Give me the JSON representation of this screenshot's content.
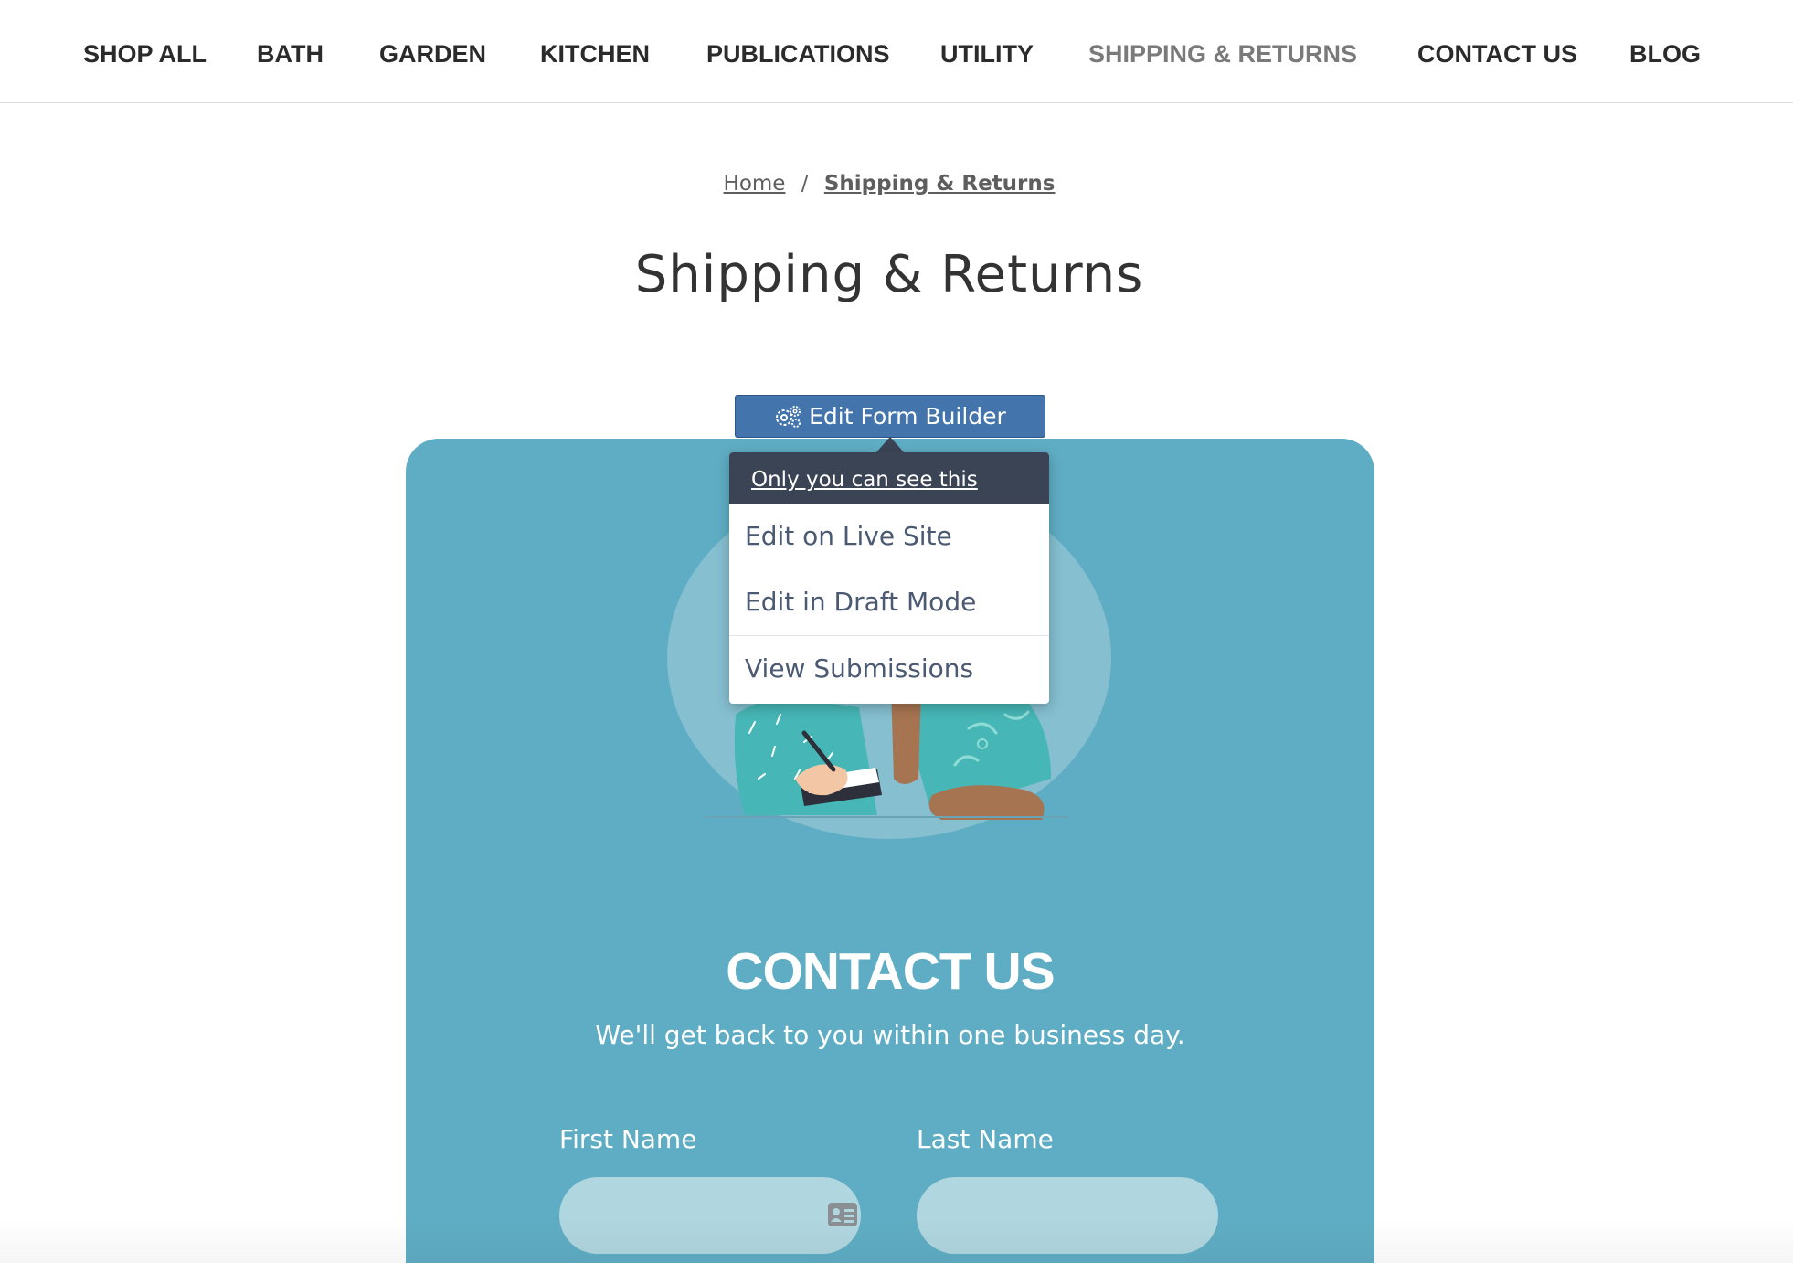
{
  "nav": {
    "items": [
      {
        "label": "SHOP ALL"
      },
      {
        "label": "BATH"
      },
      {
        "label": "GARDEN"
      },
      {
        "label": "KITCHEN"
      },
      {
        "label": "PUBLICATIONS"
      },
      {
        "label": "UTILITY"
      },
      {
        "label": "SHIPPING & RETURNS",
        "active": true
      },
      {
        "label": "CONTACT US"
      },
      {
        "label": "BLOG"
      }
    ]
  },
  "breadcrumb": {
    "home": "Home",
    "separator": "/",
    "current": "Shipping & Returns"
  },
  "page": {
    "title": "Shipping & Returns"
  },
  "form_builder": {
    "button_label": "Edit Form Builder",
    "button_icon": "gears-icon",
    "menu": {
      "header": "Only you can see this",
      "items": [
        {
          "label": "Edit on Live Site"
        },
        {
          "label": "Edit in Draft Mode"
        },
        {
          "label": "View Submissions"
        }
      ]
    }
  },
  "form": {
    "title": "CONTACT US",
    "subtitle": "We'll get back to you within one business day.",
    "fields": [
      {
        "label": "First Name",
        "value": "",
        "icon": "contact-card-icon"
      },
      {
        "label": "Last Name",
        "value": ""
      }
    ]
  },
  "colors": {
    "card_background": "#5fadc4",
    "field_background": "#b0d6df",
    "button_blue": "#4374ab",
    "menu_header": "#3b4455",
    "active_nav": "#7a7a7a"
  }
}
